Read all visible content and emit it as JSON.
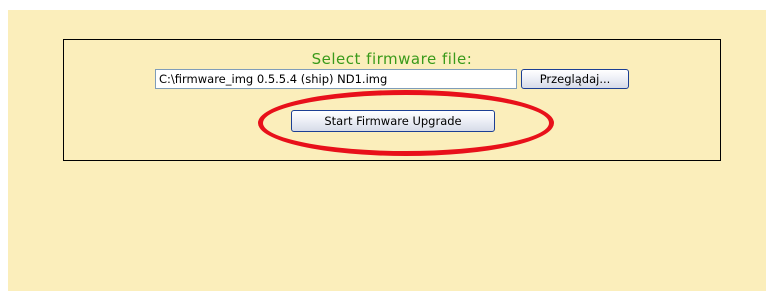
{
  "firmware_form": {
    "title": "Select firmware file:",
    "file_path_value": "C:\\firmware_img 0.5.5.4 (ship) ND1.img",
    "browse_label": "Przeglądaj...",
    "start_upgrade_label": "Start Firmware Upgrade"
  },
  "annotation": {
    "highlight_color": "#e8101a"
  },
  "colors": {
    "background": "#fbeebb",
    "title_green": "#3a9a1a"
  }
}
